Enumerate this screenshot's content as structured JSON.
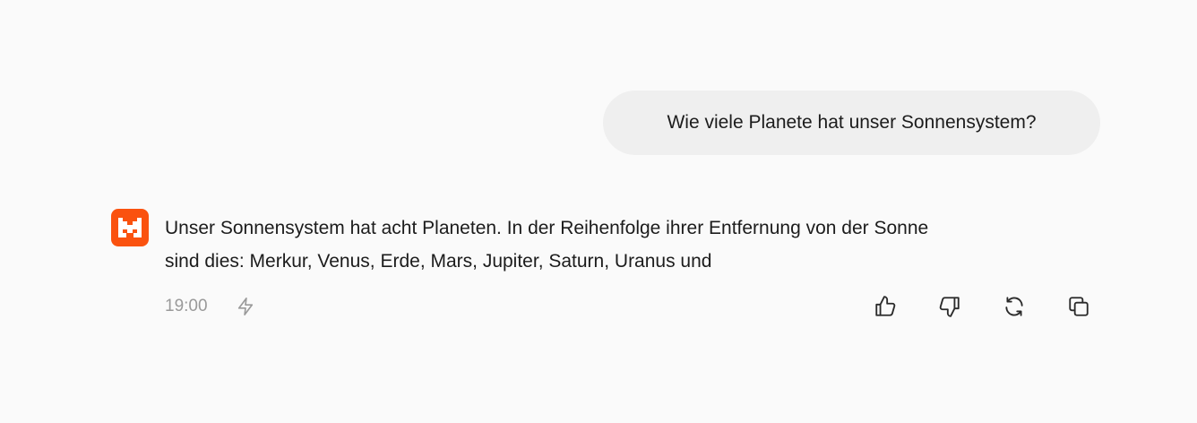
{
  "user_message": {
    "text": "Wie viele Planete hat unser Sonnensystem?"
  },
  "assistant_message": {
    "line1": "Unser Sonnensystem hat acht Planeten. In der Reihenfolge ihrer Entfernung von der Sonne",
    "line2": "sind dies: Merkur, Venus, Erde, Mars, Jupiter, Saturn, Uranus und",
    "timestamp": "19:00",
    "avatar_icon": "mistral-logo-icon",
    "status_icon": "lightning-icon"
  },
  "actions": {
    "icons": [
      "thumbs-up-icon",
      "thumbs-down-icon",
      "refresh-icon",
      "copy-icon"
    ]
  },
  "colors": {
    "brand": "#fa520f",
    "user_bubble": "#efefef",
    "background": "#fafafa",
    "muted_text": "#9a9a9a"
  }
}
